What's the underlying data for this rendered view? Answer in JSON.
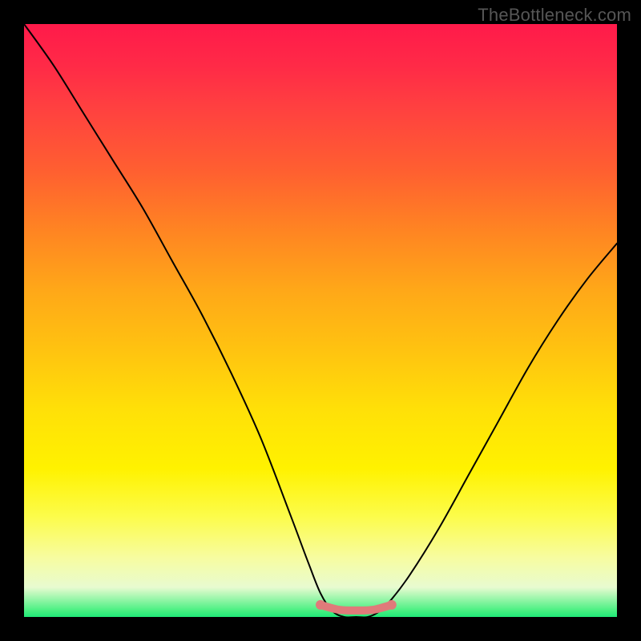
{
  "watermark": "TheBottleneck.com",
  "chart_data": {
    "type": "line",
    "title": "",
    "xlabel": "",
    "ylabel": "",
    "xlim": [
      0,
      100
    ],
    "ylim": [
      0,
      100
    ],
    "x": [
      0,
      5,
      10,
      15,
      20,
      25,
      30,
      35,
      40,
      45,
      48,
      50,
      52,
      54,
      56,
      58,
      60,
      62,
      65,
      70,
      75,
      80,
      85,
      90,
      95,
      100
    ],
    "values": [
      100,
      93,
      85,
      77,
      69,
      60,
      51,
      41,
      30,
      17,
      9,
      4,
      1,
      0,
      0,
      0,
      1,
      3,
      7,
      15,
      24,
      33,
      42,
      50,
      57,
      63
    ],
    "optimal_region": {
      "x_start": 50,
      "x_end": 62,
      "y": 1.5,
      "color": "#e07a7a"
    },
    "gradient_stops": [
      {
        "pos": 0,
        "color": "#ff1a4a"
      },
      {
        "pos": 50,
        "color": "#ffc800"
      },
      {
        "pos": 85,
        "color": "#fff860"
      },
      {
        "pos": 100,
        "color": "#20e878"
      }
    ]
  }
}
